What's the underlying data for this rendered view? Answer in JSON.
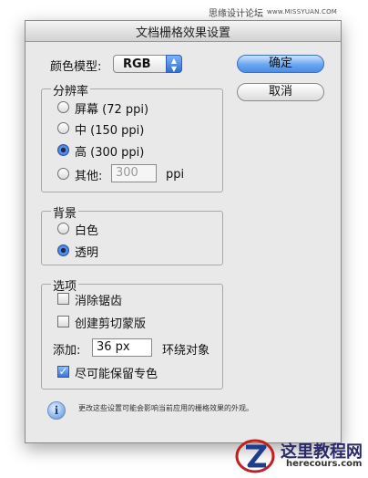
{
  "watermark": {
    "text": "思缘设计论坛",
    "site": "www.MISSYUAN.COM"
  },
  "dialog": {
    "title": "文档栅格效果设置",
    "color_model": {
      "label": "颜色模型:",
      "value": "RGB"
    },
    "buttons": {
      "ok": "确定",
      "cancel": "取消"
    },
    "resolution": {
      "title": "分辨率",
      "options": [
        {
          "label": "屏幕 (72 ppi)",
          "selected": false
        },
        {
          "label": "中 (150 ppi)",
          "selected": false
        },
        {
          "label": "高 (300 ppi)",
          "selected": true
        },
        {
          "label": "其他:",
          "selected": false
        }
      ],
      "other_value": "300",
      "other_unit": "ppi"
    },
    "background": {
      "title": "背景",
      "options": [
        {
          "label": "白色",
          "selected": false
        },
        {
          "label": "透明",
          "selected": true
        }
      ]
    },
    "options": {
      "title": "选项",
      "antialias": {
        "label": "消除锯齿",
        "checked": false
      },
      "clipping_mask": {
        "label": "创建剪切蒙版",
        "checked": false
      },
      "add": {
        "label": "添加:",
        "value": "36 px",
        "suffix": "环绕对象"
      },
      "preserve_spot": {
        "label": "尽可能保留专色",
        "checked": true
      }
    },
    "info_text": "更改这些设置可能会影响当前应用的栅格效果的外观。"
  },
  "logo": {
    "title": "这里教程网",
    "url": "herecours.com"
  },
  "colors": {
    "accent": "#3a76d8",
    "dialog_bg": "#e9e9e9"
  }
}
